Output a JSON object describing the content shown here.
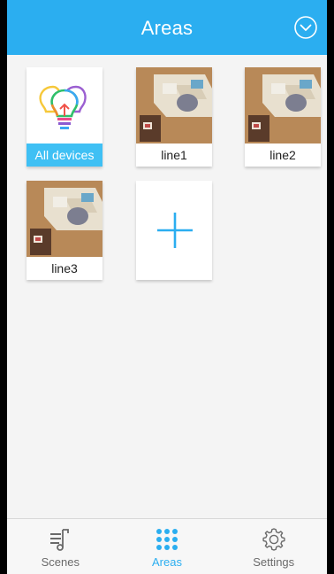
{
  "header": {
    "title": "Areas",
    "dropdown_icon": "chevron-down-circle-icon",
    "color": "#2baef0"
  },
  "areas": {
    "all_devices": {
      "label": "All devices",
      "icon": "multicolor-bulbs-icon"
    },
    "items": [
      {
        "label": "line1",
        "thumbnail": "living-room-photo"
      },
      {
        "label": "line2",
        "thumbnail": "living-room-photo"
      },
      {
        "label": "line3",
        "thumbnail": "living-room-photo"
      }
    ],
    "add_icon": "plus-icon"
  },
  "bottom_nav": {
    "items": [
      {
        "label": "Scenes",
        "icon": "scenes-icon",
        "active": false
      },
      {
        "label": "Areas",
        "icon": "grid-dots-icon",
        "active": true
      },
      {
        "label": "Settings",
        "icon": "gear-icon",
        "active": false
      }
    ]
  },
  "colors": {
    "accent": "#2baef0",
    "all_devices_label_bg": "#3fc0f4",
    "inactive_nav": "#6a6a6a"
  }
}
